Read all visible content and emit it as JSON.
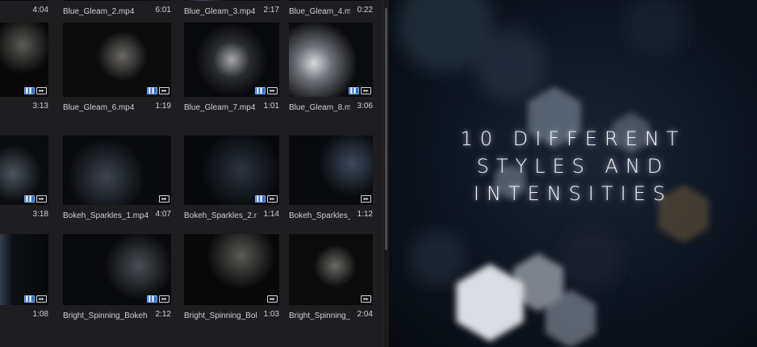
{
  "media_browser": {
    "clips": [
      {
        "name": "",
        "duration": "4:04"
      },
      {
        "name": "Blue_Gleam_2.mp4",
        "duration": "6:01"
      },
      {
        "name": "Blue_Gleam_3.mp4",
        "duration": "2:17"
      },
      {
        "name": "Blue_Gleam_4.mp4",
        "duration": "0:22"
      },
      {
        "name": "4",
        "duration": "3:13"
      },
      {
        "name": "Blue_Gleam_6.mp4",
        "duration": "1:19"
      },
      {
        "name": "Blue_Gleam_7.mp4",
        "duration": "1:01"
      },
      {
        "name": "Blue_Gleam_8.mp4",
        "duration": "3:06"
      },
      {
        "name": "4",
        "duration": "3:18"
      },
      {
        "name": "Bokeh_Sparkles_1.mp4",
        "duration": "4:07"
      },
      {
        "name": "Bokeh_Sparkles_2.mp4",
        "duration": "1:14"
      },
      {
        "name": "Bokeh_Sparkles_3.mp4",
        "duration": "1:12"
      },
      {
        "name": "kehl",
        "duration": "1:08"
      },
      {
        "name": "Bright_Spinning_Bokeh",
        "duration": "2:12"
      },
      {
        "name": "Bright_Spinning_Bokeh",
        "duration": "1:03"
      },
      {
        "name": "Bright_Spinning_Bokeh",
        "duration": "2:04"
      }
    ],
    "badge_icons": [
      "video-track-icon",
      "audio-track-icon"
    ]
  },
  "promo": {
    "lines": [
      "10 DIFFERENT",
      "STYLES AND",
      "INTENSITIES"
    ]
  },
  "colors": {
    "panel_bg": "#1e1e21",
    "thumb_bg": "#050608",
    "badge_blue": "#2b6fd6",
    "promo_bg": "#0d1521"
  }
}
